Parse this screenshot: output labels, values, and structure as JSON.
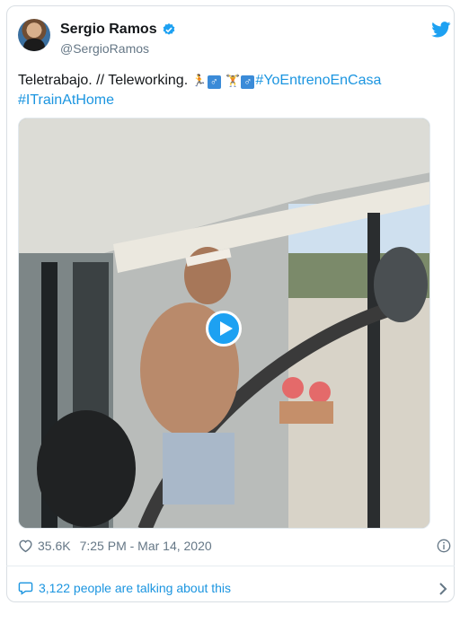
{
  "author": {
    "name": "Sergio Ramos",
    "handle": "@SergioRamos",
    "verified": true
  },
  "tweet": {
    "text_plain": "Teletrabajo. // Teleworking.",
    "hashtag_1": "#YoEntrenoEnCasa",
    "hashtag_2": "#ITrainAtHome"
  },
  "stats": {
    "likes": "35.6K",
    "timestamp": "7:25 PM - Mar 14, 2020"
  },
  "footer": {
    "talking": "3,122 people are talking about this"
  },
  "colors": {
    "link": "#1b95e0",
    "play_button": "#1da1f2",
    "verified": "#1da1f2"
  },
  "icons": [
    "verified-badge-icon",
    "twitter-bird-icon",
    "play-icon",
    "heart-icon",
    "info-icon",
    "comment-bubble-icon",
    "chevron-right-icon"
  ]
}
